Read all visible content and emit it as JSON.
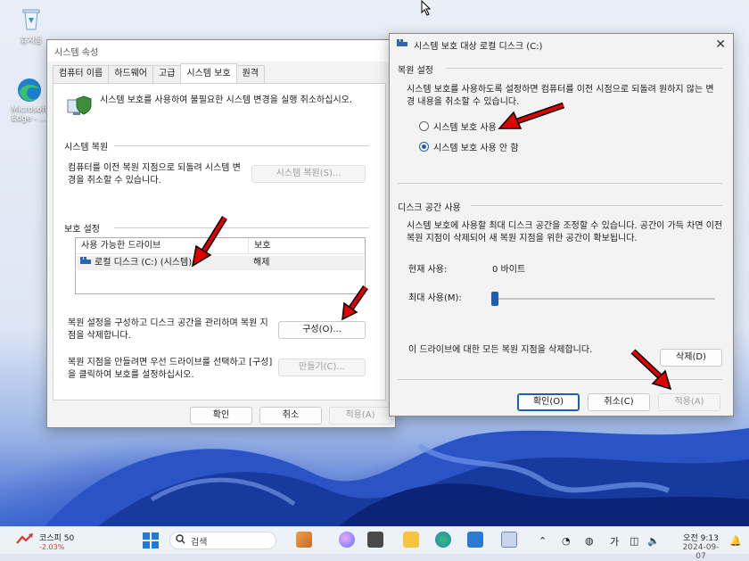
{
  "desktop": {
    "icons": [
      {
        "label": "휴지통",
        "icon": "recycle-bin-icon"
      },
      {
        "label": "Microsoft Edge - ...",
        "icon": "edge-icon"
      }
    ]
  },
  "system_properties": {
    "title": "시스템 속성",
    "tabs": [
      "컴퓨터 이름",
      "하드웨어",
      "고급",
      "시스템 보호",
      "원격"
    ],
    "active_tab": "시스템 보호",
    "intro_text": "시스템 보호를 사용하여 불필요한 시스템 변경을 실행 취소하십시오.",
    "restore_section": "시스템 복원",
    "restore_desc": "컴퓨터를 이전 복원 지점으로 되돌려 시스템 변경을 취소할 수 있습니다.",
    "restore_button": "시스템 복원(S)...",
    "protection_section": "보호 설정",
    "table_headers": [
      "사용 가능한 드라이브",
      "보호"
    ],
    "drives": [
      {
        "name": "로컬 디스크 (C:) (시스템)",
        "protection": "해제"
      }
    ],
    "configure_desc": "복원 설정을 구성하고 디스크 공간을 관리하며 복원 지점을 삭제합니다.",
    "configure_button": "구성(O)...",
    "create_desc": "복원 지점을 만들려면 우선 드라이브를 선택하고 [구성]을 클릭하여 보호를 설정하십시오.",
    "create_button": "만들기(C)...",
    "ok_button": "확인",
    "cancel_button": "취소",
    "apply_button": "적용(A)"
  },
  "protection_dialog": {
    "title": "시스템 보호 대상 로컬 디스크 (C:)",
    "restore_settings_section": "복원 설정",
    "restore_settings_desc": "시스템 보호를 사용하도록 설정하면 컴퓨터를 이전 시점으로 되돌려 원하지 않는 변경 내용을 취소할 수 있습니다.",
    "option_on": "시스템 보호 사용",
    "option_off": "시스템 보호 사용 안 함",
    "selected_option": "시스템 보호 사용 안 함",
    "disk_section": "디스크 공간 사용",
    "disk_desc": "시스템 보호에 사용할 최대 디스크 공간을 조정할 수 있습니다. 공간이 가득 차면 이전 복원 지점이 삭제되어 새 복원 지점을 위한 공간이 확보됩니다.",
    "current_usage_label": "현재 사용:",
    "current_usage_value": "0 바이트",
    "max_usage_label": "최대 사용(M):",
    "max_usage_fraction": 0,
    "delete_desc": "이 드라이브에 대한 모든 복원 지점을 삭제합니다.",
    "delete_button": "삭제(D)",
    "ok_button": "확인(O)",
    "cancel_button": "취소(C)",
    "apply_button": "적용(A)"
  },
  "taskbar": {
    "stock_name": "코스피",
    "stock_value": "50",
    "stock_change": "-2.03%",
    "search_placeholder": "검색",
    "language": "가",
    "time": "오전 9:13",
    "date": "2024-09-07"
  },
  "colors": {
    "accent": "#1a5fb4",
    "arrow_red": "#e00000",
    "stock_down": "#d23b2a"
  }
}
